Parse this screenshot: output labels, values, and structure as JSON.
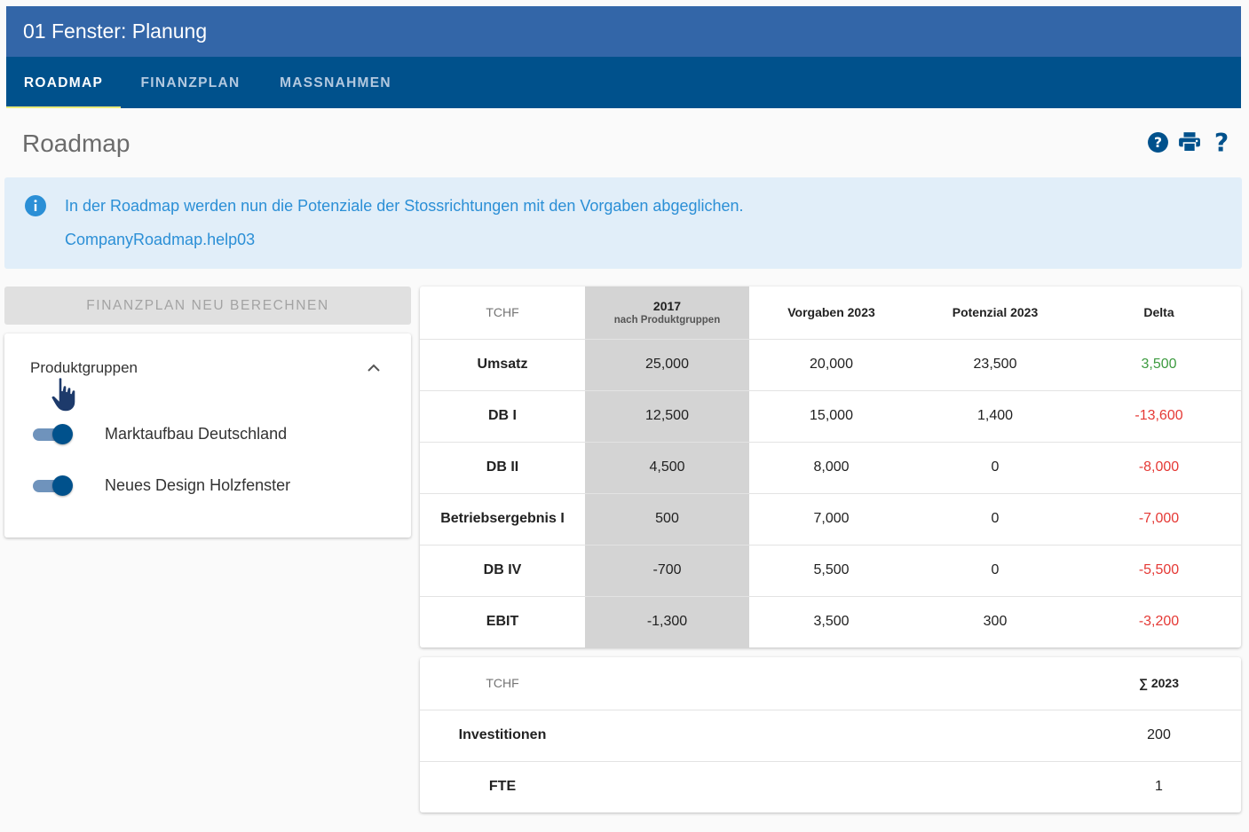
{
  "app_title": "01 Fenster: Planung",
  "tabs": [
    {
      "label": "ROADMAP",
      "active": true
    },
    {
      "label": "FINANZPLAN",
      "active": false
    },
    {
      "label": "MASSNAHMEN",
      "active": false
    }
  ],
  "page_title": "Roadmap",
  "header_icons": [
    "help-circle-icon",
    "print-icon",
    "question-mark-icon"
  ],
  "info": {
    "icon": "info-icon",
    "line1": "In der Roadmap werden nun die Potenziale der Stossrichtungen mit den Vorgaben abgeglichen.",
    "line2": "CompanyRoadmap.help03"
  },
  "recalc_button": "FINANZPLAN NEU BERECHNEN",
  "produktgruppen": {
    "title": "Produktgruppen",
    "items": [
      {
        "label": "Marktaufbau Deutschland",
        "on": true
      },
      {
        "label": "Neues Design Holzfenster",
        "on": true
      }
    ]
  },
  "main_table": {
    "unit": "TCHF",
    "col_2017": "2017",
    "col_2017_sub": "nach Produktgruppen",
    "col_vorgaben": "Vorgaben 2023",
    "col_potenzial": "Potenzial 2023",
    "col_delta": "Delta",
    "rows": [
      {
        "label": "Umsatz",
        "v2017": "25,000",
        "vorgaben": "20,000",
        "potenzial": "23,500",
        "delta": "3,500",
        "delta_sign": "pos"
      },
      {
        "label": "DB I",
        "v2017": "12,500",
        "vorgaben": "15,000",
        "potenzial": "1,400",
        "delta": "-13,600",
        "delta_sign": "neg"
      },
      {
        "label": "DB II",
        "v2017": "4,500",
        "vorgaben": "8,000",
        "potenzial": "0",
        "delta": "-8,000",
        "delta_sign": "neg"
      },
      {
        "label": "Betriebsergebnis I",
        "v2017": "500",
        "vorgaben": "7,000",
        "potenzial": "0",
        "delta": "-7,000",
        "delta_sign": "neg"
      },
      {
        "label": "DB IV",
        "v2017": "-700",
        "vorgaben": "5,500",
        "potenzial": "0",
        "delta": "-5,500",
        "delta_sign": "neg"
      },
      {
        "label": "EBIT",
        "v2017": "-1,300",
        "vorgaben": "3,500",
        "potenzial": "300",
        "delta": "-3,200",
        "delta_sign": "neg"
      }
    ]
  },
  "invest_table": {
    "unit": "TCHF",
    "col_sum": "∑ 2023",
    "rows": [
      {
        "label": "Investitionen",
        "value": "200"
      },
      {
        "label": "FTE",
        "value": "1"
      }
    ]
  },
  "colors": {
    "title_bar": "#3366a8",
    "tab_bar": "#00518c",
    "tab_indicator": "#e8ea7a",
    "info_bg": "#e1eef9",
    "info_text": "#2b8fd6",
    "positive": "#3d9b40",
    "negative": "#e53935",
    "highlight_col": "#d4d4d4"
  }
}
